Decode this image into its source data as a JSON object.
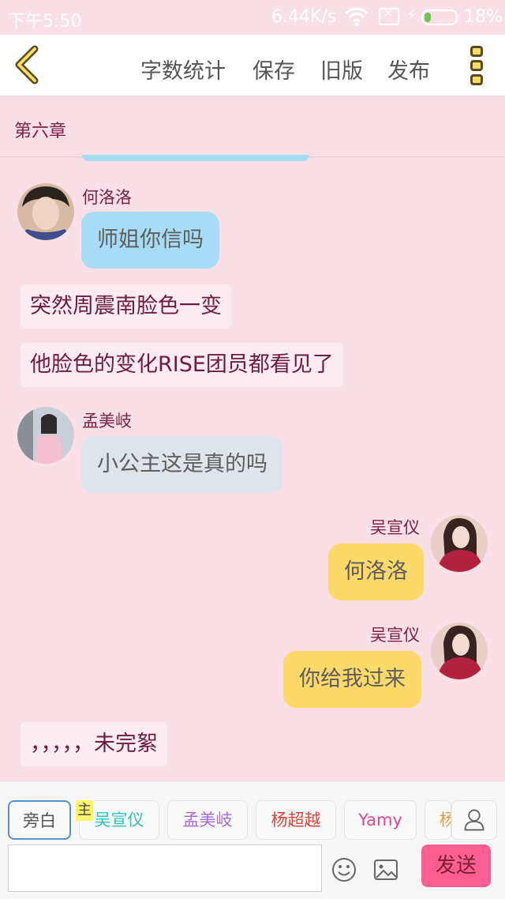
{
  "status_bar": {
    "time": "下午5:50",
    "network_speed": "6.44K/s",
    "battery": "18%"
  },
  "header": {
    "menu": {
      "word_count": "字数统计",
      "save": "保存",
      "old_version": "旧版",
      "publish": "发布"
    }
  },
  "chapter": {
    "title": "第六章"
  },
  "messages": [
    {
      "speaker": "何洛洛",
      "text": "师姐你信吗"
    },
    {
      "narration": "突然周震南脸色一变"
    },
    {
      "narration": "他脸色的变化RISE团员都看见了"
    },
    {
      "speaker": "孟美岐",
      "text": "小公主这是真的吗"
    },
    {
      "speaker": "吴宣仪",
      "text": "何洛洛"
    },
    {
      "speaker": "吴宣仪",
      "text": "你给我过来"
    },
    {
      "narration": "，，，，，未完絮"
    }
  ],
  "roles": [
    "旁白",
    "吴宣仪",
    "孟美岐",
    "杨超越",
    "Yamy",
    "杨"
  ],
  "host_badge": "主",
  "composer": {
    "input_value": "",
    "send_label": "发送"
  },
  "colors": {
    "background": "#fbdfe6",
    "send_button": "#ff5e93",
    "role_colors": [
      "#555555",
      "#2ec4b6",
      "#a46bd6",
      "#d9473c",
      "#e0458f",
      "#e09a3c"
    ]
  },
  "icons": [
    "back-icon",
    "more-icon",
    "emoji-icon",
    "image-icon",
    "person-icon",
    "wifi-icon",
    "battery-icon"
  ]
}
